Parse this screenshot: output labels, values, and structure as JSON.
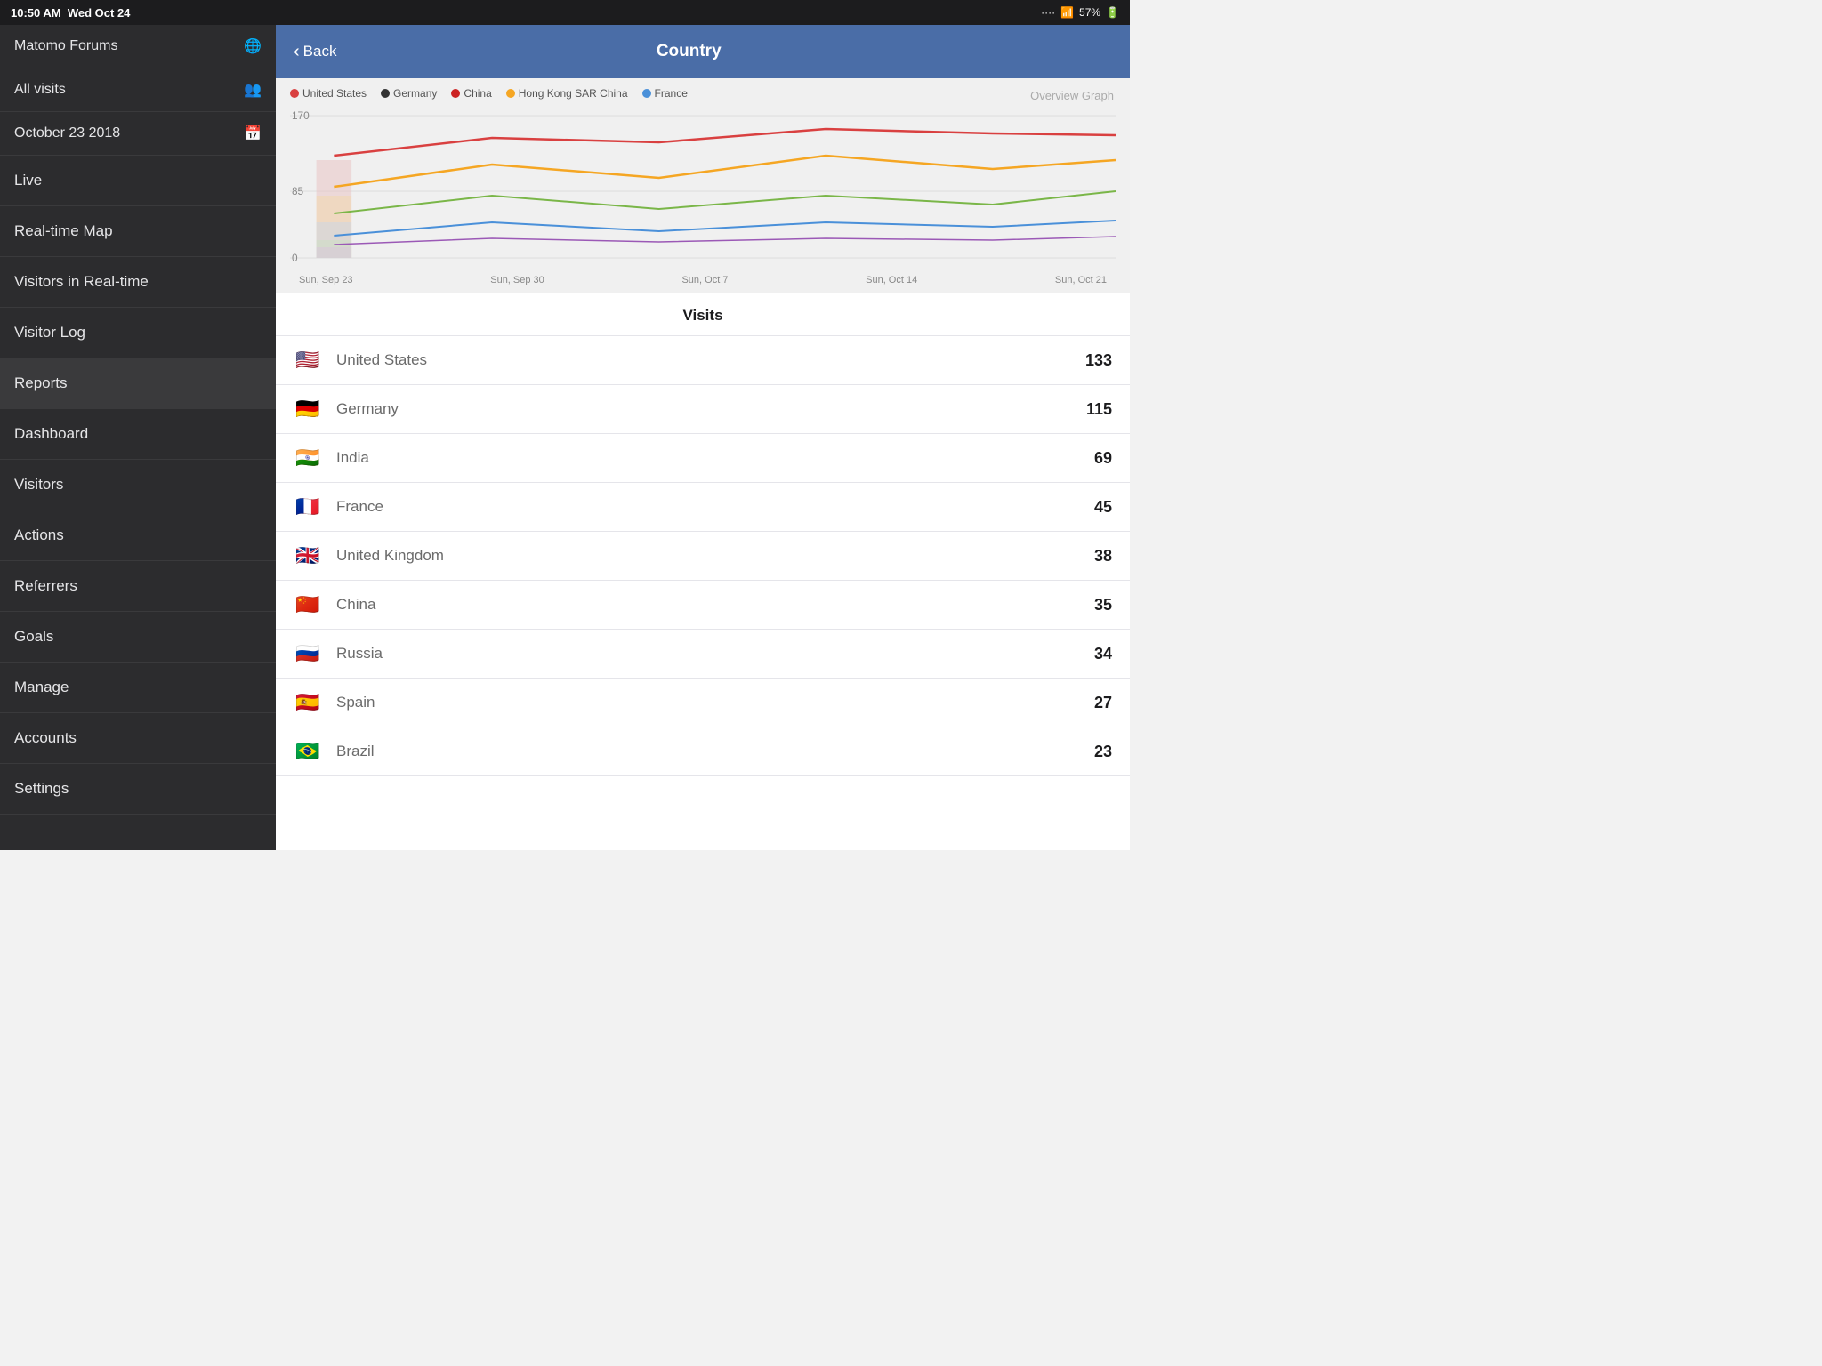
{
  "statusBar": {
    "time": "10:50 AM",
    "day": "Wed Oct 24",
    "battery": "57%"
  },
  "sidebar": {
    "app_name": "Matomo Forums",
    "segment": "All visits",
    "date": "October 23 2018",
    "items": [
      {
        "id": "live",
        "label": "Live",
        "active": false
      },
      {
        "id": "realtime-map",
        "label": "Real-time Map",
        "active": false
      },
      {
        "id": "visitors-realtime",
        "label": "Visitors in Real-time",
        "active": false
      },
      {
        "id": "visitor-log",
        "label": "Visitor Log",
        "active": false
      },
      {
        "id": "reports",
        "label": "Reports",
        "active": true
      },
      {
        "id": "dashboard",
        "label": "Dashboard",
        "active": false
      },
      {
        "id": "visitors",
        "label": "Visitors",
        "active": false
      },
      {
        "id": "actions",
        "label": "Actions",
        "active": false
      },
      {
        "id": "referrers",
        "label": "Referrers",
        "active": false
      },
      {
        "id": "goals",
        "label": "Goals",
        "active": false
      },
      {
        "id": "manage",
        "label": "Manage",
        "active": false
      },
      {
        "id": "accounts",
        "label": "Accounts",
        "active": false
      },
      {
        "id": "settings",
        "label": "Settings",
        "active": false
      }
    ]
  },
  "topBar": {
    "back_label": "Back",
    "title": "Country",
    "overview_label": "Overview Graph"
  },
  "chart": {
    "yMax": 170,
    "yMid": 85,
    "yMin": 0,
    "x_labels": [
      "Sun, Sep 23",
      "Sun, Sep 30",
      "Sun, Oct 7",
      "Sun, Oct 14",
      "Sun, Oct 21"
    ],
    "legend": [
      {
        "id": "us",
        "label": "United States",
        "color": "#d94040"
      },
      {
        "id": "de",
        "label": "Germany",
        "color": "#333333"
      },
      {
        "id": "cn",
        "label": "China",
        "color": "#cc2222"
      },
      {
        "id": "hk",
        "label": "Hong Kong SAR China",
        "color": "#f5a623"
      },
      {
        "id": "fr",
        "label": "France",
        "color": "#4a90d9"
      }
    ]
  },
  "visits_header": "Visits",
  "countries": [
    {
      "id": "us",
      "flag": "🇺🇸",
      "name": "United States",
      "visits": 133
    },
    {
      "id": "de",
      "flag": "🇩🇪",
      "name": "Germany",
      "visits": 115
    },
    {
      "id": "in",
      "flag": "🇮🇳",
      "name": "India",
      "visits": 69
    },
    {
      "id": "fr",
      "flag": "🇫🇷",
      "name": "France",
      "visits": 45
    },
    {
      "id": "gb",
      "flag": "🇬🇧",
      "name": "United Kingdom",
      "visits": 38
    },
    {
      "id": "cn",
      "flag": "🇨🇳",
      "name": "China",
      "visits": 35
    },
    {
      "id": "ru",
      "flag": "🇷🇺",
      "name": "Russia",
      "visits": 34
    },
    {
      "id": "es",
      "flag": "🇪🇸",
      "name": "Spain",
      "visits": 27
    },
    {
      "id": "br",
      "flag": "🇧🇷",
      "name": "Brazil",
      "visits": 23
    }
  ]
}
